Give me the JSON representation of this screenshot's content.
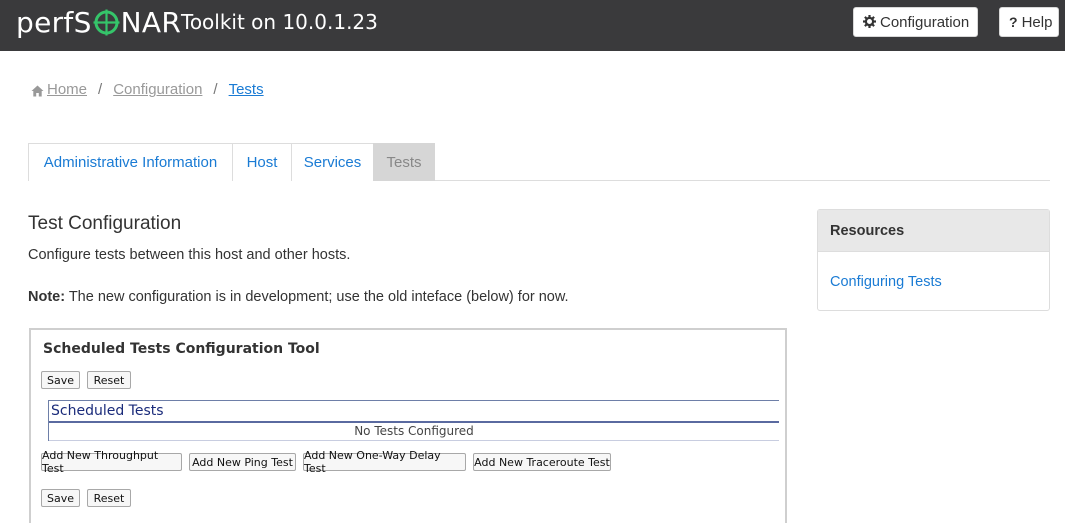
{
  "navbar": {
    "brand_left": "perfS",
    "brand_right": "NAR",
    "brand_icon": "crosshair-logo",
    "title": "Toolkit on 10.0.1.23",
    "configuration_button": {
      "icon": "gear-icon",
      "label": "Configuration"
    },
    "help_button": {
      "icon": "question-icon",
      "label": "Help"
    },
    "bg_color": "#3a3a3c"
  },
  "breadcrumb": {
    "items": [
      {
        "icon": "home-icon",
        "label": "Home"
      },
      {
        "label": "Configuration"
      },
      {
        "label": "Tests"
      }
    ],
    "separator": "/"
  },
  "tabs": [
    {
      "label": "Administrative Information",
      "active": false
    },
    {
      "label": "Host",
      "active": false
    },
    {
      "label": "Services",
      "active": false
    },
    {
      "label": "Tests",
      "active": true
    }
  ],
  "main": {
    "title": "Test Configuration",
    "lead": "Configure tests between this host and other hosts.",
    "note_label": "Note:",
    "note_text": " The new configuration is in development; use the old inteface (below) for now."
  },
  "tool": {
    "title": "Scheduled Tests Configuration Tool",
    "save_label": "Save",
    "reset_label": "Reset",
    "scheduled_header": "Scheduled Tests",
    "empty_message": "No Tests Configured",
    "add_buttons": [
      "Add New Throughput Test",
      "Add New Ping Test",
      "Add New One-Way Delay Test",
      "Add New Traceroute Test"
    ]
  },
  "resources": {
    "title": "Resources",
    "link": "Configuring Tests"
  },
  "colors": {
    "link": "#1a7bd4",
    "brand_green": "#35c46a"
  }
}
